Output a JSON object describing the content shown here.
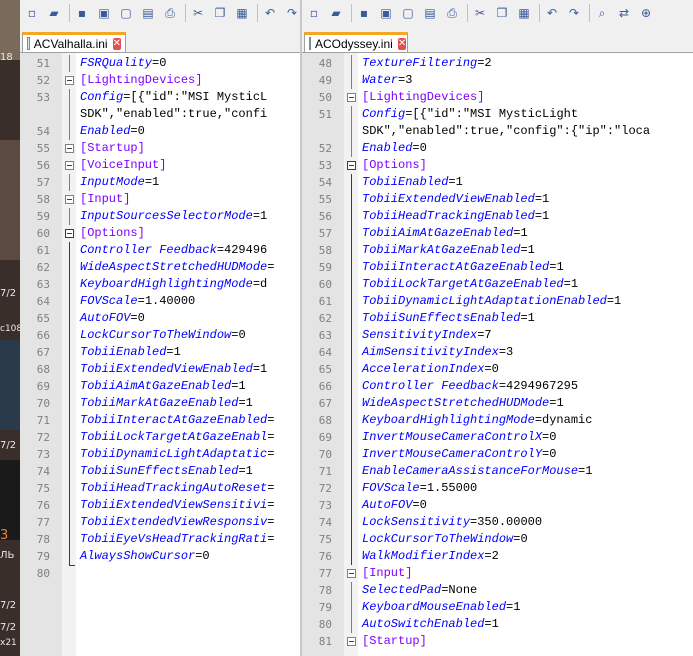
{
  "left_pane": {
    "tab_label": "ACValhalla.ini",
    "lines": [
      {
        "n": "51",
        "k": "FSRQuality",
        "v": "0"
      },
      {
        "n": "52",
        "sec": "[LightingDevices]"
      },
      {
        "n": "53",
        "k": "Config",
        "v": "[{\"id\":\"MSI MysticL"
      },
      {
        "n": "",
        "c": "SDK\",\"enabled\":true,\"confi"
      },
      {
        "n": "54",
        "k": "Enabled",
        "v": "0"
      },
      {
        "n": "55",
        "sec": "[Startup]"
      },
      {
        "n": "56",
        "sec": "[VoiceInput]"
      },
      {
        "n": "57",
        "k": "InputMode",
        "v": "1"
      },
      {
        "n": "58",
        "sec": "[Input]"
      },
      {
        "n": "59",
        "k": "InputSourcesSelectorMode",
        "v": "1"
      },
      {
        "n": "60",
        "sec": "[Options]"
      },
      {
        "n": "61",
        "k": "Controller Feedback",
        "v": "429496"
      },
      {
        "n": "62",
        "k": "WideAspectStretchedHUDMode",
        "v": ""
      },
      {
        "n": "63",
        "k": "KeyboardHighlightingMode",
        "v": "d"
      },
      {
        "n": "64",
        "k": "FOVScale",
        "v": "1.40000"
      },
      {
        "n": "65",
        "k": "AutoFOV",
        "v": "0"
      },
      {
        "n": "66",
        "k": "LockCursorToTheWindow",
        "v": "0"
      },
      {
        "n": "67",
        "k": "TobiiEnabled",
        "v": "1"
      },
      {
        "n": "68",
        "k": "TobiiExtendedViewEnabled",
        "v": "1"
      },
      {
        "n": "69",
        "k": "TobiiAimAtGazeEnabled",
        "v": "1"
      },
      {
        "n": "70",
        "k": "TobiiMarkAtGazeEnabled",
        "v": "1"
      },
      {
        "n": "71",
        "k": "TobiiInteractAtGazeEnabled",
        "v": ""
      },
      {
        "n": "72",
        "k": "TobiiLockTargetAtGazeEnabl",
        "v": ""
      },
      {
        "n": "73",
        "k": "TobiiDynamicLightAdaptatic",
        "v": ""
      },
      {
        "n": "74",
        "k": "TobiiSunEffectsEnabled",
        "v": "1"
      },
      {
        "n": "75",
        "k": "TobiiHeadTrackingAutoReset",
        "v": ""
      },
      {
        "n": "76",
        "k": "TobiiExtendedViewSensitivi",
        "v": ""
      },
      {
        "n": "77",
        "k": "TobiiExtendedViewResponsiv",
        "v": ""
      },
      {
        "n": "78",
        "k": "TobiiEyeVsHeadTrackingRati",
        "v": ""
      },
      {
        "n": "79",
        "k": "AlwaysShowCursor",
        "v": "0"
      },
      {
        "n": "80",
        "empty": true
      }
    ]
  },
  "right_pane": {
    "tab_label": "ACOdyssey.ini",
    "lines": [
      {
        "n": "48",
        "k": "TextureFiltering",
        "v": "2"
      },
      {
        "n": "49",
        "k": "Water",
        "v": "3"
      },
      {
        "n": "50",
        "sec": "[LightingDevices]"
      },
      {
        "n": "51",
        "k": "Config",
        "v": "[{\"id\":\"MSI MysticLight"
      },
      {
        "n": "",
        "c": "SDK\",\"enabled\":true,\"config\":{\"ip\":\"loca"
      },
      {
        "n": "52",
        "k": "Enabled",
        "v": "0"
      },
      {
        "n": "53",
        "sec": "[Options]"
      },
      {
        "n": "54",
        "k": "TobiiEnabled",
        "v": "1"
      },
      {
        "n": "55",
        "k": "TobiiExtendedViewEnabled",
        "v": "1"
      },
      {
        "n": "56",
        "k": "TobiiHeadTrackingEnabled",
        "v": "1"
      },
      {
        "n": "57",
        "k": "TobiiAimAtGazeEnabled",
        "v": "1"
      },
      {
        "n": "58",
        "k": "TobiiMarkAtGazeEnabled",
        "v": "1"
      },
      {
        "n": "59",
        "k": "TobiiInteractAtGazeEnabled",
        "v": "1"
      },
      {
        "n": "60",
        "k": "TobiiLockTargetAtGazeEnabled",
        "v": "1"
      },
      {
        "n": "61",
        "k": "TobiiDynamicLightAdaptationEnabled",
        "v": "1"
      },
      {
        "n": "62",
        "k": "TobiiSunEffectsEnabled",
        "v": "1"
      },
      {
        "n": "63",
        "k": "SensitivityIndex",
        "v": "7"
      },
      {
        "n": "64",
        "k": "AimSensitivityIndex",
        "v": "3"
      },
      {
        "n": "65",
        "k": "AccelerationIndex",
        "v": "0"
      },
      {
        "n": "66",
        "k": "Controller Feedback",
        "v": "4294967295"
      },
      {
        "n": "67",
        "k": "WideAspectStretchedHUDMode",
        "v": "1"
      },
      {
        "n": "68",
        "k": "KeyboardHighlightingMode",
        "v": "dynamic"
      },
      {
        "n": "69",
        "k": "InvertMouseCameraControlX",
        "v": "0"
      },
      {
        "n": "70",
        "k": "InvertMouseCameraControlY",
        "v": "0"
      },
      {
        "n": "71",
        "k": "EnableCameraAssistanceForMouse",
        "v": "1"
      },
      {
        "n": "72",
        "k": "FOVScale",
        "v": "1.55000"
      },
      {
        "n": "73",
        "k": "AutoFOV",
        "v": "0"
      },
      {
        "n": "74",
        "k": "LockSensitivity",
        "v": "350.00000"
      },
      {
        "n": "75",
        "k": "LockCursorToTheWindow",
        "v": "0"
      },
      {
        "n": "76",
        "k": "WalkModifierIndex",
        "v": "2"
      },
      {
        "n": "77",
        "sec": "[Input]"
      },
      {
        "n": "78",
        "k": "SelectedPad",
        "v": "None"
      },
      {
        "n": "79",
        "k": "KeyboardMouseEnabled",
        "v": "1"
      },
      {
        "n": "80",
        "k": "AutoSwitchEnabled",
        "v": "1"
      },
      {
        "n": "81",
        "sec": "[Startup]"
      }
    ]
  },
  "background_strip": {
    "fragments": [
      "18",
      "7/2",
      "c108",
      "7/2",
      "3",
      "ЛЬ",
      "7/2",
      "7/2",
      "x21"
    ]
  },
  "colors": {
    "key": "#0000ff",
    "section": "#8000ff",
    "value": "#000000",
    "line_number": "#808080",
    "fold_active": "#cc0000",
    "tab_accent": "#f5a623"
  },
  "toolbar_icons": [
    "new-file-icon",
    "open-folder-icon",
    "save-icon",
    "save-all-icon",
    "close-icon",
    "close-all-icon",
    "print-icon",
    "cut-icon",
    "copy-icon",
    "paste-icon",
    "undo-icon",
    "redo-icon",
    "find-icon",
    "replace-icon",
    "zoom-in-icon"
  ]
}
